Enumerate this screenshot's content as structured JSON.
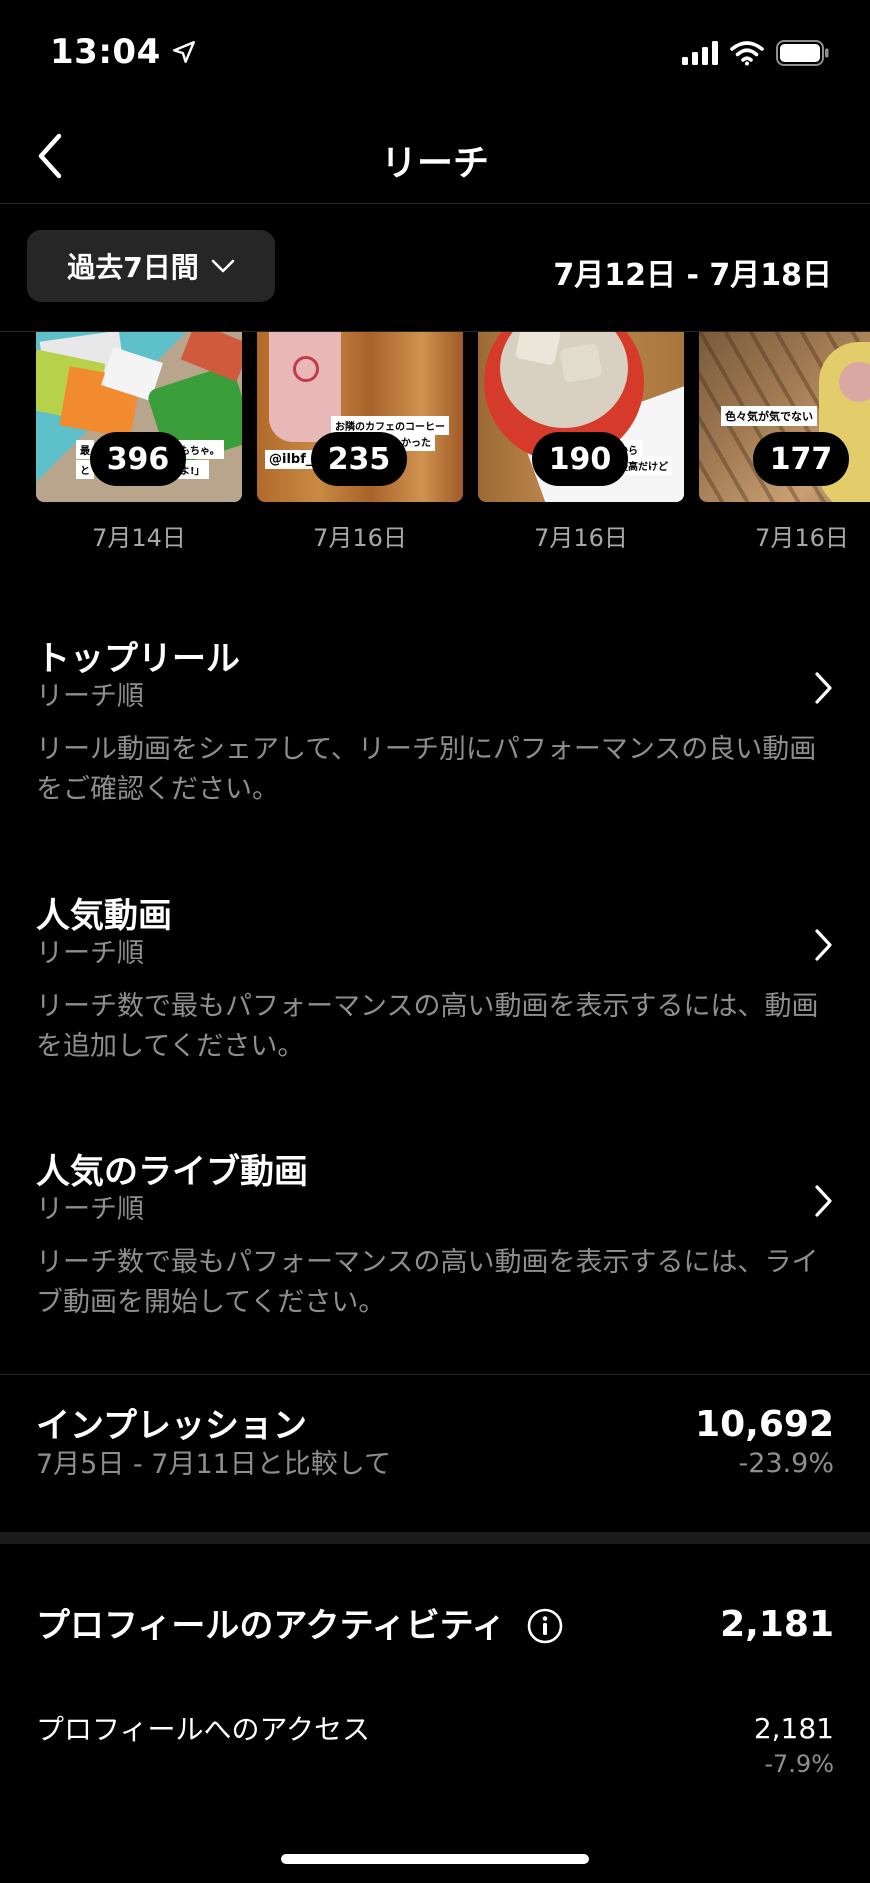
{
  "status_bar": {
    "time": "13:04"
  },
  "nav": {
    "title": "リーチ"
  },
  "filter": {
    "period_label": "過去7日間",
    "date_range": "7月12日 - 7月18日"
  },
  "thumbnails": [
    {
      "count": "396",
      "date": "7月14日",
      "sticker_a": "最",
      "sticker_b": "もちゃ。",
      "sticker_c": "と",
      "sticker_d": "よ!」"
    },
    {
      "count": "235",
      "date": "7月16日",
      "sticker_a": "お隣のカフェのコーヒー",
      "sticker_b": "美味しかった",
      "sticker_c": "@ilbf_"
    },
    {
      "count": "190",
      "date": "7月16日",
      "sticker_a": "から",
      "sticker_b": "最高だけど"
    },
    {
      "count": "177",
      "date": "7月16日",
      "sticker_a": "色々気が気でない"
    }
  ],
  "sections": [
    {
      "title": "トップリール",
      "subtitle": "リーチ順",
      "description": "リール動画をシェアして、リーチ別にパフォーマンスの良い動画をご確認ください。"
    },
    {
      "title": "人気動画",
      "subtitle": "リーチ順",
      "description": "リーチ数で最もパフォーマンスの高い動画を表示するには、動画を追加してください。"
    },
    {
      "title": "人気のライブ動画",
      "subtitle": "リーチ順",
      "description": "リーチ数で最もパフォーマンスの高い動画を表示するには、ライブ動画を開始してください。"
    }
  ],
  "impressions": {
    "title": "インプレッション",
    "compare": "7月5日 - 7月11日と比較して",
    "value": "10,692",
    "change": "-23.9%"
  },
  "profile_activity": {
    "title": "プロフィールのアクティビティ",
    "value": "2,181",
    "rows": [
      {
        "label": "プロフィールへのアクセス",
        "value": "2,181",
        "change": "-7.9%"
      }
    ]
  },
  "colors": {
    "background": "#000000",
    "secondary_text": "#8e8e8e",
    "button_bg": "#262626"
  }
}
